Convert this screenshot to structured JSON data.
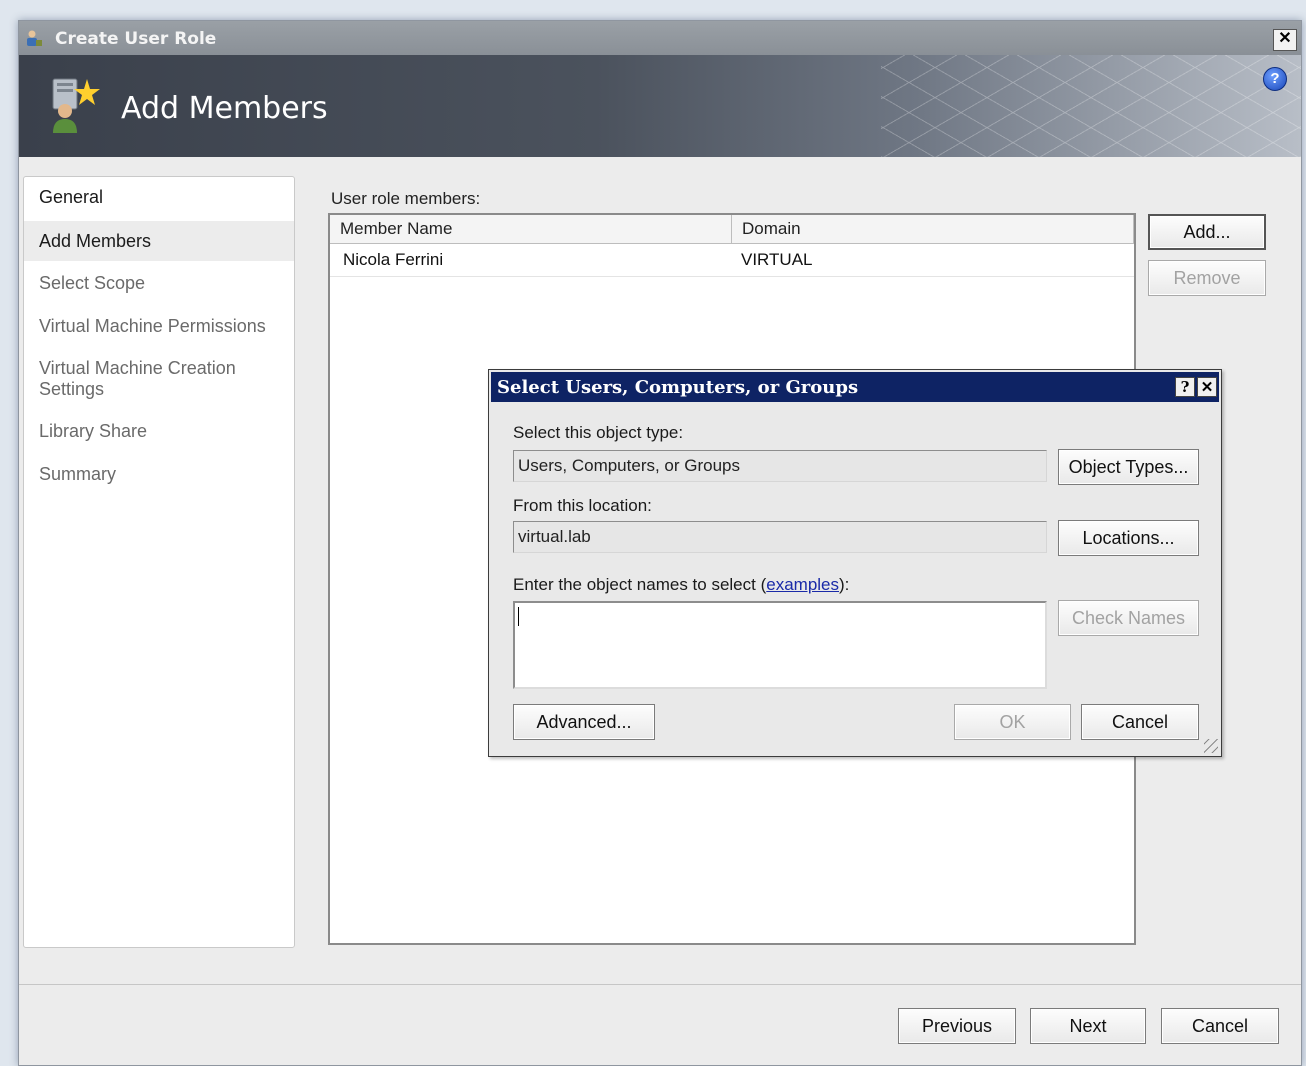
{
  "window": {
    "title": "Create User Role",
    "close_glyph": "✕"
  },
  "header": {
    "title": "Add Members",
    "help_glyph": "?"
  },
  "nav": {
    "items": [
      {
        "label": "General"
      },
      {
        "label": "Add Members",
        "active": true
      },
      {
        "label": "Select Scope"
      },
      {
        "label": "Virtual Machine Permissions"
      },
      {
        "label": "Virtual Machine Creation Settings"
      },
      {
        "label": "Library Share"
      },
      {
        "label": "Summary"
      }
    ]
  },
  "members": {
    "label": "User role members:",
    "columns": [
      "Member Name",
      "Domain"
    ],
    "rows": [
      {
        "name": "Nicola Ferrini",
        "domain": "VIRTUAL"
      }
    ],
    "add_label": "Add...",
    "remove_label": "Remove"
  },
  "dialog": {
    "title": "Select Users, Computers, or Groups",
    "help_glyph": "?",
    "close_glyph": "✕",
    "object_type_label": "Select this object type:",
    "object_type_value": "Users, Computers, or Groups",
    "object_types_button": "Object Types...",
    "location_label": "From this location:",
    "location_value": "virtual.lab",
    "locations_button": "Locations...",
    "names_label": "Enter the object names to select",
    "names_link": "examples",
    "names_suffix": "):",
    "names_prefix": " (",
    "check_names_button": "Check Names",
    "advanced_button": "Advanced...",
    "ok_button": "OK",
    "cancel_button": "Cancel"
  },
  "footer": {
    "previous": "Previous",
    "next": "Next",
    "cancel": "Cancel"
  },
  "colors": {
    "dialog_title_bg": "#0e2364",
    "header_bg": "#3a404b",
    "link": "#1a2aa8"
  }
}
